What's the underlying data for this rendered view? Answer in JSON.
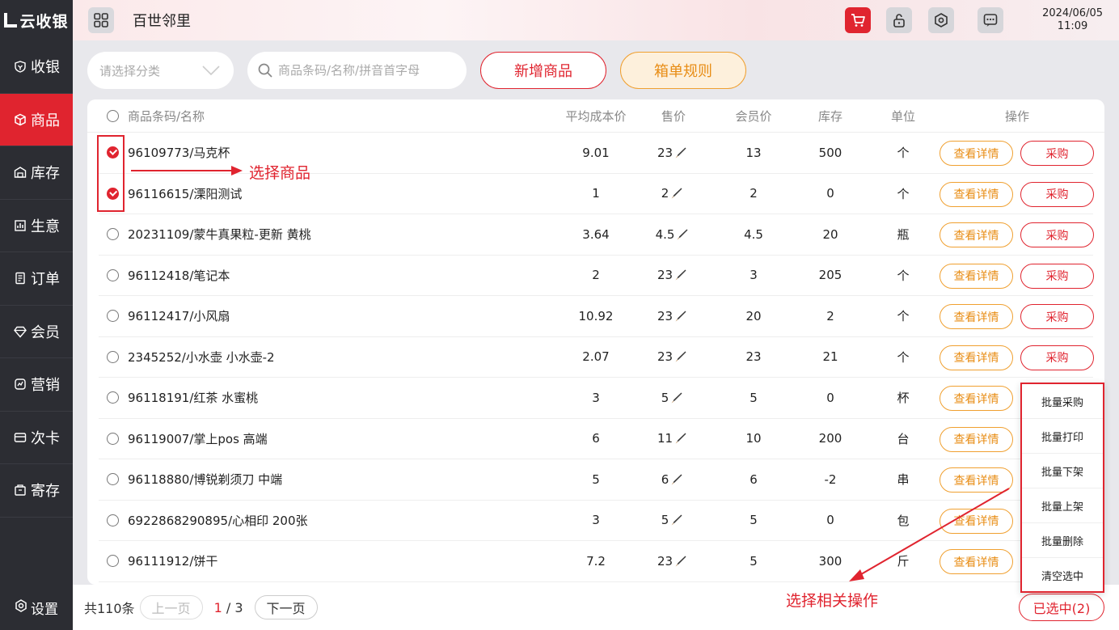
{
  "sidebar": {
    "logo": "云收银",
    "items": [
      {
        "label": "收银",
        "icon": "cashier-icon"
      },
      {
        "label": "商品",
        "icon": "box-icon",
        "active": true
      },
      {
        "label": "库存",
        "icon": "warehouse-icon"
      },
      {
        "label": "生意",
        "icon": "chart-icon"
      },
      {
        "label": "订单",
        "icon": "order-icon"
      },
      {
        "label": "会员",
        "icon": "diamond-icon"
      },
      {
        "label": "营销",
        "icon": "marketing-icon"
      },
      {
        "label": "次卡",
        "icon": "card-icon"
      },
      {
        "label": "寄存",
        "icon": "storage-icon"
      }
    ],
    "settings": "设置"
  },
  "header": {
    "store_name": "百世邻里",
    "date": "2024/06/05",
    "time": "11:09"
  },
  "toolbar": {
    "category_placeholder": "请选择分类",
    "search_placeholder": "商品条码/名称/拼音首字母",
    "new_product": "新增商品",
    "box_rules": "箱单规则"
  },
  "table": {
    "headers": {
      "name": "商品条码/名称",
      "cost": "平均成本价",
      "price": "售价",
      "member": "会员价",
      "stock": "库存",
      "unit": "单位",
      "actions": "操作"
    },
    "detail_label": "查看详情",
    "buy_label": "采购",
    "rows": [
      {
        "name": "96109773/马克杯",
        "cost": "9.01",
        "price": "23",
        "member": "13",
        "stock": "500",
        "unit": "个",
        "checked": true
      },
      {
        "name": "96116615/溧阳测试",
        "cost": "1",
        "price": "2",
        "member": "2",
        "stock": "0",
        "unit": "个",
        "checked": true
      },
      {
        "name": "20231109/蒙牛真果粒-更新 黄桃",
        "cost": "3.64",
        "price": "4.5",
        "member": "4.5",
        "stock": "20",
        "unit": "瓶",
        "checked": false
      },
      {
        "name": "96112418/笔记本",
        "cost": "2",
        "price": "23",
        "member": "3",
        "stock": "205",
        "unit": "个",
        "checked": false
      },
      {
        "name": "96112417/小风扇",
        "cost": "10.92",
        "price": "23",
        "member": "20",
        "stock": "2",
        "unit": "个",
        "checked": false
      },
      {
        "name": "2345252/小水壶 小水壶-2",
        "cost": "2.07",
        "price": "23",
        "member": "23",
        "stock": "21",
        "unit": "个",
        "checked": false
      },
      {
        "name": "96118191/红茶 水蜜桃",
        "cost": "3",
        "price": "5",
        "member": "5",
        "stock": "0",
        "unit": "杯",
        "checked": false
      },
      {
        "name": "96119007/掌上pos 高端",
        "cost": "6",
        "price": "11",
        "member": "10",
        "stock": "200",
        "unit": "台",
        "checked": false
      },
      {
        "name": "96118880/博锐剃须刀 中端",
        "cost": "5",
        "price": "6",
        "member": "6",
        "stock": "-2",
        "unit": "串",
        "checked": false
      },
      {
        "name": "6922868290895/心相印 200张",
        "cost": "3",
        "price": "5",
        "member": "5",
        "stock": "0",
        "unit": "包",
        "checked": false
      },
      {
        "name": "96111912/饼干",
        "cost": "7.2",
        "price": "23",
        "member": "5",
        "stock": "300",
        "unit": "斤",
        "checked": false
      }
    ]
  },
  "footer": {
    "total": "共110条",
    "prev": "上一页",
    "current_page": "1",
    "total_pages": "/ 3",
    "next": "下一页",
    "selected": "已选中(2)"
  },
  "batch_menu": [
    "批量采购",
    "批量打印",
    "批量下架",
    "批量上架",
    "批量删除",
    "清空选中"
  ],
  "annotations": {
    "select_product": "选择商品",
    "select_action": "选择相关操作"
  },
  "colors": {
    "primary": "#e0242f",
    "orange": "#e88d15",
    "sidebar_bg": "#2c2d33"
  }
}
